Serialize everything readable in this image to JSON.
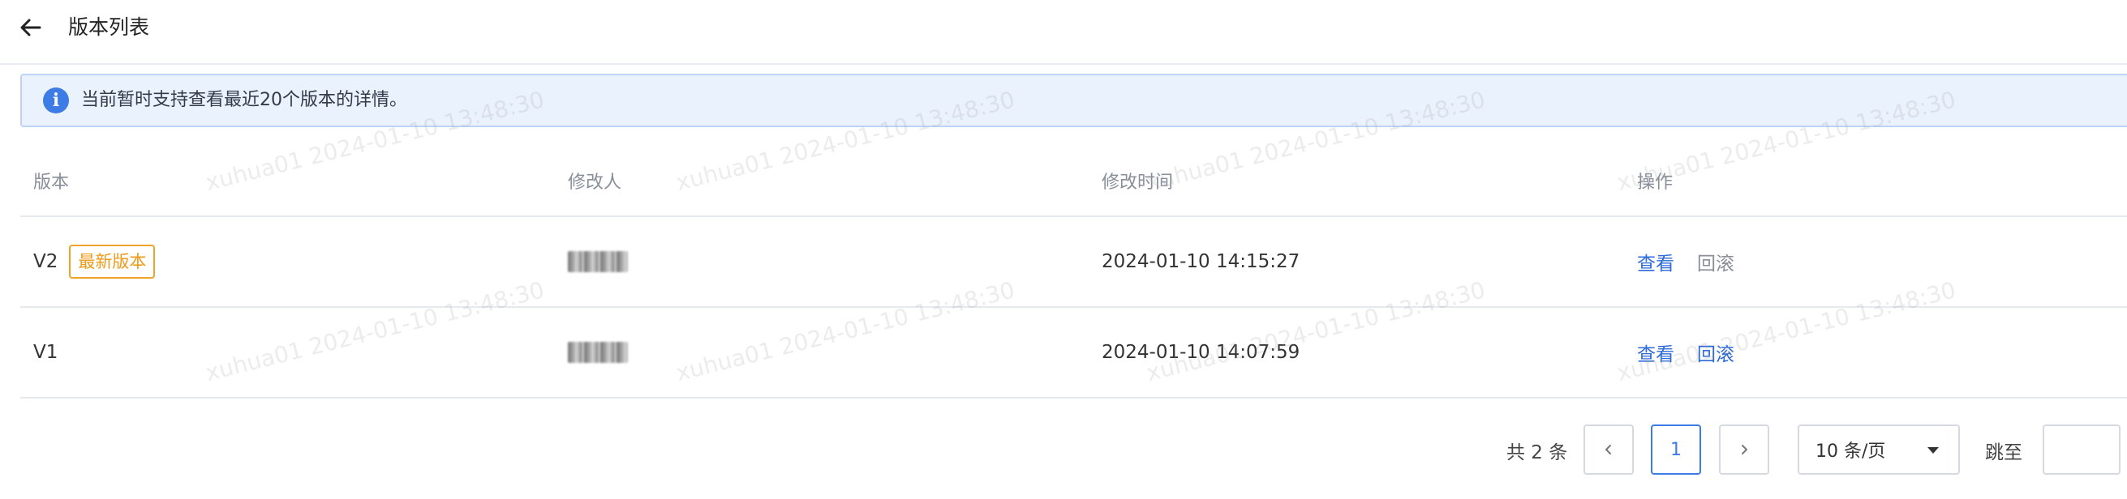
{
  "header": {
    "back_icon": "arrow-left-icon",
    "title": "版本列表"
  },
  "alert": {
    "icon": "info-icon",
    "icon_glyph": "i",
    "text": "当前暂时支持查看最近20个版本的详情。"
  },
  "table": {
    "columns": [
      "版本",
      "修改人",
      "修改时间",
      "操作"
    ],
    "rows": [
      {
        "version": "V2",
        "tag": "最新版本",
        "modified_time": "2024-01-10 14:15:27",
        "actions": {
          "view": "查看",
          "rollback": "回滚"
        },
        "rollback_enabled": false
      },
      {
        "version": "V1",
        "tag": "",
        "modified_time": "2024-01-10 14:07:59",
        "actions": {
          "view": "查看",
          "rollback": "回滚"
        },
        "rollback_enabled": true
      }
    ]
  },
  "pagination": {
    "total_text": "共 2 条",
    "prev_icon": "chevron-left-icon",
    "next_icon": "chevron-right-icon",
    "current_page": "1",
    "page_size": "10 条/页",
    "jump_label": "跳至",
    "jump_value": ""
  },
  "watermark": {
    "text": "xuhua01 2024-01-10 13:48:30"
  },
  "colors": {
    "primary": "#3d7be6",
    "link": "#2f6bd8",
    "tag": "#ee9a1a",
    "alert_bg": "#eaf2fd"
  }
}
